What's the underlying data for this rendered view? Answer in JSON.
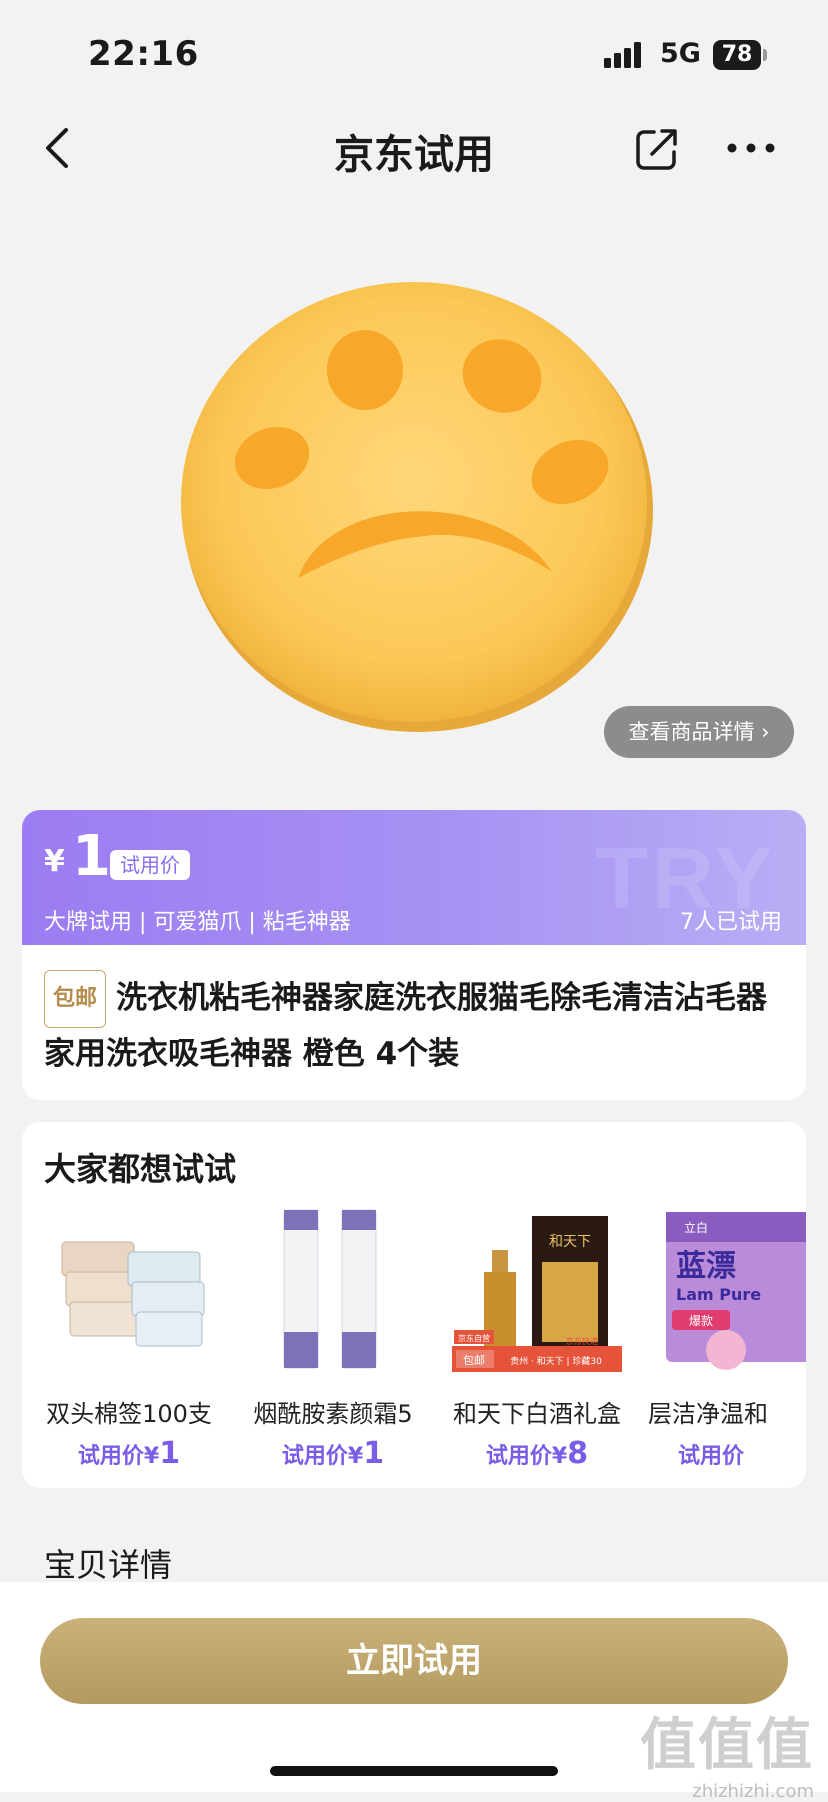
{
  "status_bar": {
    "time": "22:16",
    "network": "5G",
    "battery": "78"
  },
  "nav": {
    "title": "京东试用"
  },
  "hero": {
    "detail_button": "查看商品详情",
    "detail_chevron": "›"
  },
  "price_card": {
    "currency": "¥",
    "price": "1",
    "price_tag": "试用价",
    "tags": "大牌试用 | 可爱猫爪 | 粘毛神器",
    "tried_count": "7人已试用",
    "free_shipping": "包邮",
    "product_title": "洗衣机粘毛神器家庭洗衣服猫毛除毛清洁沾毛器家用洗衣吸毛神器 橙色 4个装",
    "watermark": "TRY"
  },
  "recommend": {
    "heading": "大家都想试试",
    "items": [
      {
        "name": "双头棉签100支",
        "price_label": "试用价",
        "currency": "¥",
        "price": "1"
      },
      {
        "name": "烟酰胺素颜霜5",
        "price_label": "试用价",
        "currency": "¥",
        "price": "1"
      },
      {
        "name": "和天下白酒礼盒",
        "price_label": "试用价",
        "currency": "¥",
        "price": "8"
      },
      {
        "name": "层洁净温和",
        "price_label": "试用价",
        "currency": "",
        "price": ""
      }
    ],
    "item3_badge": "京东自营",
    "item3_badge2": "包邮",
    "item3_brand": "和天下",
    "item3_banner": "贵州 · 和天下 | 珍藏30",
    "item3_delivery": "京东快递",
    "item4_brand": "蓝漂",
    "item4_sub": "Lam Pure",
    "item4_tag": "爆款",
    "item4_logo": "立白"
  },
  "section": {
    "title": "宝贝详情"
  },
  "bottom": {
    "cta": "立即试用",
    "watermark": "值值值",
    "watermark_url": "zhizhizhi.com"
  },
  "colors": {
    "accent_purple": "#9b7cf2",
    "gold": "#c9b27a",
    "price_text": "#7a5ce6"
  }
}
